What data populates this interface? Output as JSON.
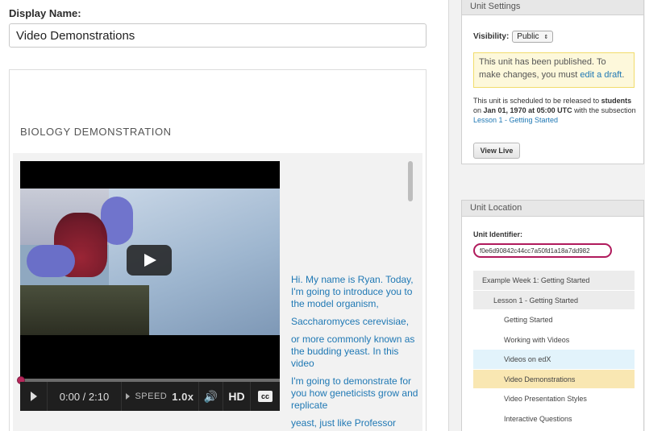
{
  "editor": {
    "display_name_label": "Display Name:",
    "display_name_value": "Video Demonstrations",
    "section_title": "BIOLOGY DEMONSTRATION"
  },
  "video": {
    "time": "0:00 / 2:10",
    "speed_label": "SPEED",
    "speed_value": "1.0x",
    "hd_label": "HD",
    "cc_label": "cc",
    "progress": 0,
    "transcript": [
      "Hi. My name is Ryan. Today, I'm going to introduce you to the model organism,",
      "Saccharomyces cerevisiae,",
      "or more commonly known as the budding yeast. In this video",
      "I'm going to demonstrate for you how geneticists grow and replicate",
      "yeast, just like Professor Lander"
    ]
  },
  "unit_settings": {
    "header": "Unit Settings",
    "visibility_label": "Visibility:",
    "visibility_value": "Public",
    "notice_text": "This unit has been published. To make changes, you must",
    "notice_link": "edit a draft",
    "notice_end": ".",
    "sched_prefix": "This unit is scheduled to be released to",
    "sched_audience": "students",
    "sched_mid": "on",
    "sched_date": "Jan 01, 1970 at 05:00 UTC",
    "sched_suffix": "with the subsection",
    "sched_link": "Lesson 1 - Getting Started",
    "view_live": "View Live"
  },
  "unit_location": {
    "header": "Unit Location",
    "identifier_label": "Unit Identifier:",
    "identifier_value": "f0e6d90842c44cc7a50fd1a18a7dd982",
    "tree": [
      {
        "label": "Example Week 1: Getting Started",
        "level": "week",
        "state": "normal"
      },
      {
        "label": "Lesson 1 - Getting Started",
        "level": "lesson",
        "state": "normal"
      },
      {
        "label": "Getting Started",
        "level": "unit",
        "state": "normal"
      },
      {
        "label": "Working with Videos",
        "level": "unit",
        "state": "normal"
      },
      {
        "label": "Videos on edX",
        "level": "unit",
        "state": "highlight"
      },
      {
        "label": "Video Demonstrations",
        "level": "unit",
        "state": "current"
      },
      {
        "label": "Video Presentation Styles",
        "level": "unit",
        "state": "normal"
      },
      {
        "label": "Interactive Questions",
        "level": "unit",
        "state": "normal"
      }
    ]
  }
}
